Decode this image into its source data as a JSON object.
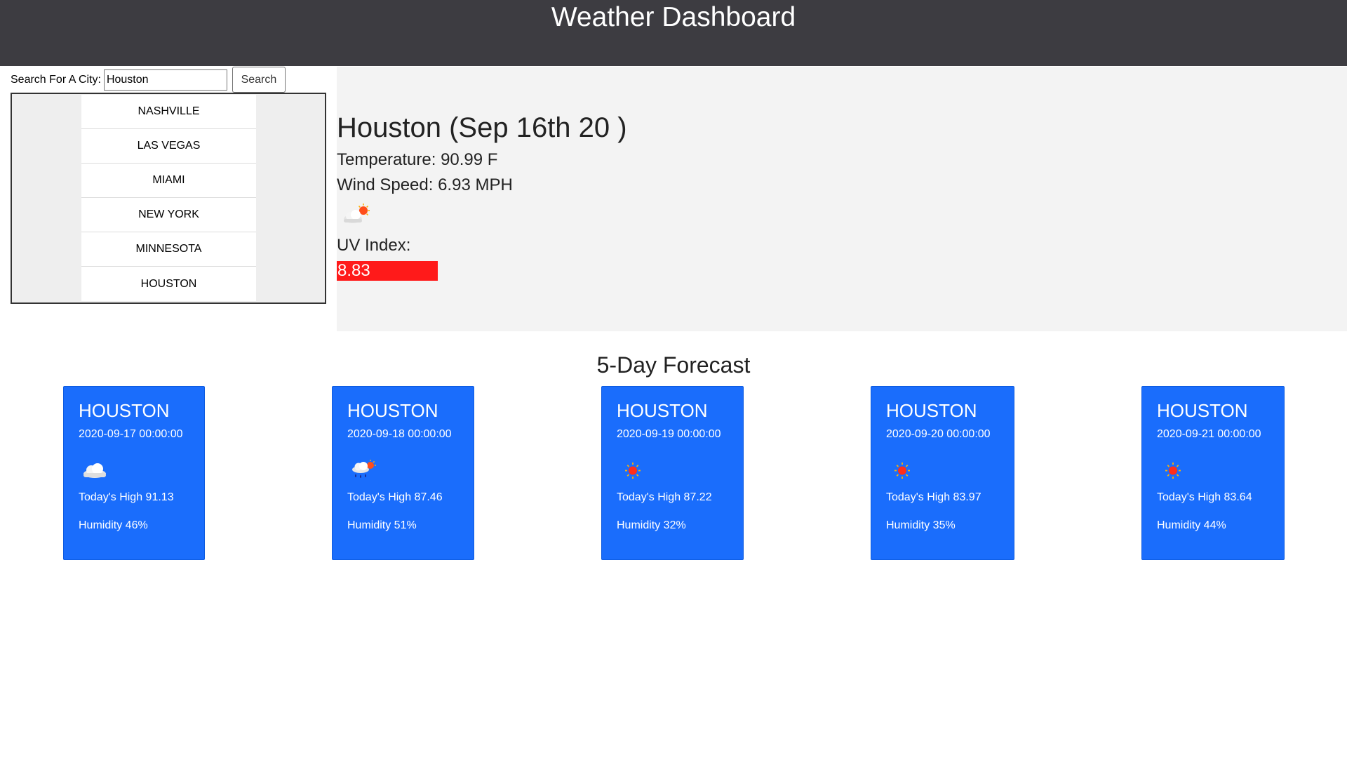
{
  "header": {
    "title": "Weather Dashboard"
  },
  "search": {
    "label": "Search For A City:",
    "value": "Houston",
    "button_label": "Search"
  },
  "history": [
    {
      "label": "NASHVILLE"
    },
    {
      "label": "LAS VEGAS"
    },
    {
      "label": "MIAMI"
    },
    {
      "label": "NEW YORK"
    },
    {
      "label": "MINNESOTA"
    },
    {
      "label": "HOUSTON"
    }
  ],
  "current": {
    "title": "Houston (Sep 16th 20 )",
    "temperature": "Temperature: 90.99 F",
    "wind": "Wind Speed: 6.93 MPH",
    "icon": "partly-cloudy-icon",
    "uv_label": "UV Index:",
    "uv_value": "8.83",
    "uv_color": "#ff1a1a"
  },
  "forecast": {
    "heading": "5-Day Forecast",
    "accent_color": "#1a6dfc",
    "days": [
      {
        "city": "HOUSTON",
        "date": "2020-09-17 00:00:00",
        "icon": "cloud-icon",
        "high": "Today's High 91.13",
        "humidity": "Humidity 46%"
      },
      {
        "city": "HOUSTON",
        "date": "2020-09-18 00:00:00",
        "icon": "rain-sun-icon",
        "high": "Today's High 87.46",
        "humidity": "Humidity 51%"
      },
      {
        "city": "HOUSTON",
        "date": "2020-09-19 00:00:00",
        "icon": "sun-icon",
        "high": "Today's High 87.22",
        "humidity": "Humidity 32%"
      },
      {
        "city": "HOUSTON",
        "date": "2020-09-20 00:00:00",
        "icon": "sun-icon",
        "high": "Today's High 83.97",
        "humidity": "Humidity 35%"
      },
      {
        "city": "HOUSTON",
        "date": "2020-09-21 00:00:00",
        "icon": "sun-icon",
        "high": "Today's High 83.64",
        "humidity": "Humidity 44%"
      }
    ]
  }
}
